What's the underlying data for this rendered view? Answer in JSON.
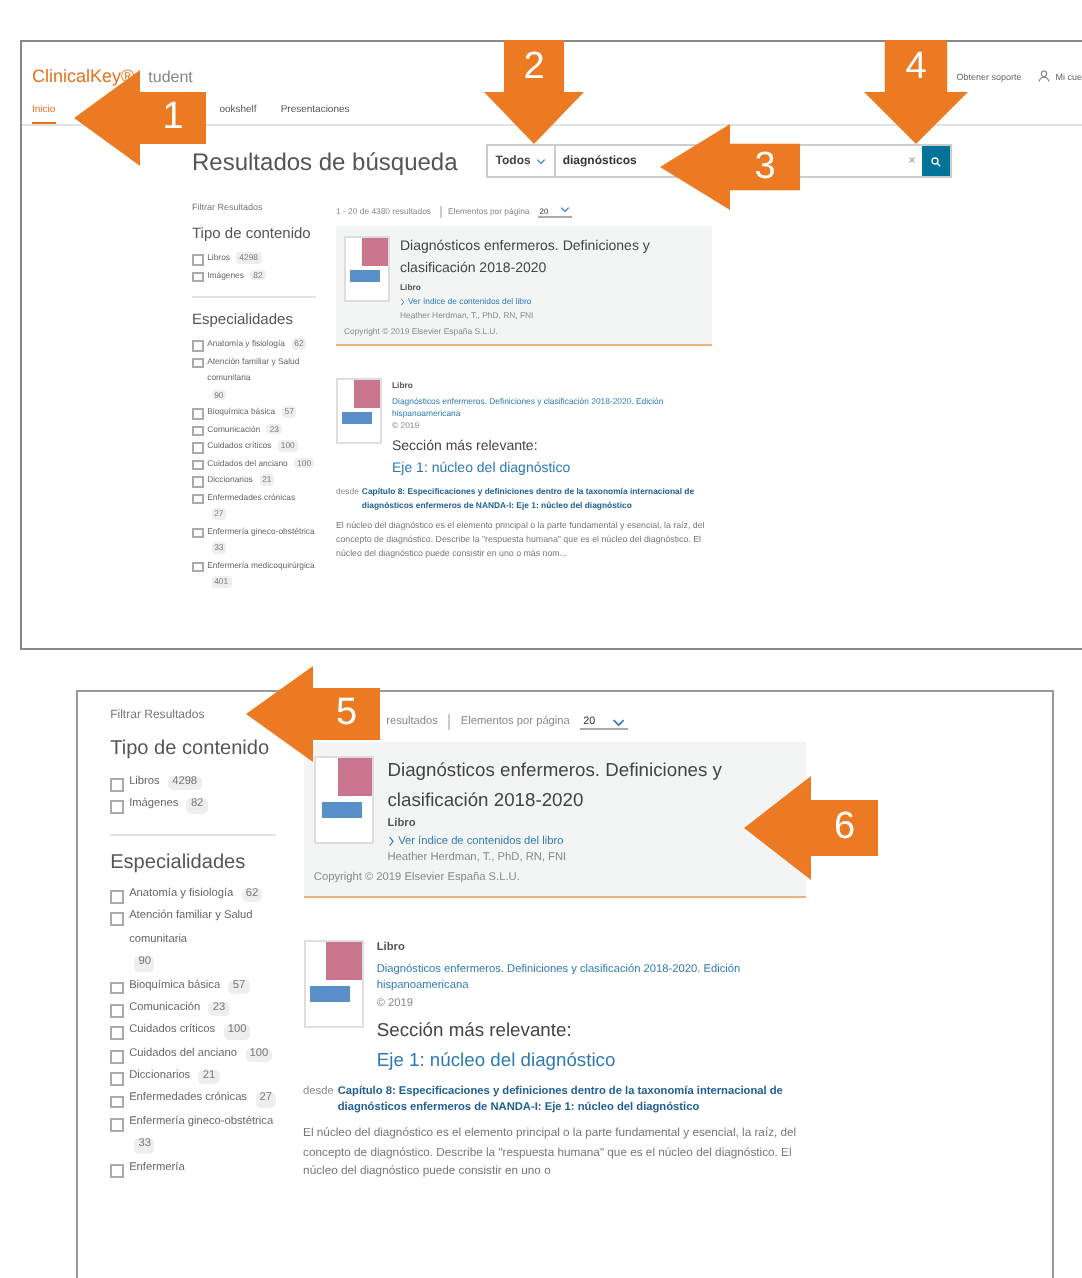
{
  "top_view": {
    "header": {
      "logo": "ClinicalKey®",
      "logo_suffix": "tudent",
      "nav": [
        {
          "label": "Inicio",
          "selected": true
        },
        {
          "label": "ookshelf",
          "selected": false
        },
        {
          "label": "Presentaciones",
          "selected": false
        }
      ],
      "support_link": "Obtener soporte",
      "account_link": "Mi cue"
    },
    "page_title": "Resultados de búsqueda",
    "search": {
      "scope": "Todos",
      "value": "diagnósticos",
      "clear_symbol": "×"
    },
    "results_bar": {
      "count": "1 - 20 de 4380 resultados",
      "per_page_label": "Elementos por página",
      "per_page": "20"
    },
    "filters": {
      "title": "Filtrar Resultados",
      "groups": [
        {
          "title": "Tipo de contenido",
          "options": [
            {
              "label": "Libros",
              "count": "4298",
              "checked": false
            },
            {
              "label": "Imágenes",
              "count": "82",
              "checked": false
            }
          ]
        },
        {
          "title": "Especialidades",
          "options": [
            {
              "label": "Anatomía y fisiología",
              "count": "62",
              "checked": false
            },
            {
              "label": "Atención familiar y Salud comunitaria",
              "count": "90",
              "checked": false
            },
            {
              "label": "Bioquímica básica",
              "count": "57",
              "checked": false
            },
            {
              "label": "Comunicación",
              "count": "23",
              "checked": false
            },
            {
              "label": "Cuidados críticos",
              "count": "100",
              "checked": false
            },
            {
              "label": "Cuidados del anciano",
              "count": "100",
              "checked": false
            },
            {
              "label": "Diccionarios",
              "count": "21",
              "checked": false
            },
            {
              "label": "Enfermedades crónicas",
              "count": "27",
              "checked": false
            },
            {
              "label": "Enfermería gineco-obstétrica",
              "count": "33",
              "checked": false
            },
            {
              "label": "Enfermería medicoquirúrgica",
              "count": "401",
              "checked": false
            }
          ]
        }
      ]
    },
    "results": [
      {
        "kind": "book",
        "highlighted": true,
        "title": "Diagnósticos enfermeros. Definiciones y clasificación 2018-2020",
        "type": "Libro",
        "toc_link": "Ver índice de contenidos del libro",
        "author": "Heather Herdman, T., PhD, RN, FNI",
        "copyright": "Copyright © 2019 Elsevier España S.L.U."
      },
      {
        "kind": "section",
        "type": "Libro",
        "source_link": "Diagnósticos enfermeros. Definiciones y clasificación 2018-2020. Edición hispanoamericana",
        "source_year": "© 2019",
        "section_label": "Sección más relevante:",
        "section_link": "Eje 1: núcleo del diagnóstico",
        "from_label": "desde",
        "from_link": "Capítulo 8: Especificaciones y definiciones dentro de la taxonomía internacional de diagnósticos enfermeros de NANDA-I: Eje 1: núcleo del diagnóstico",
        "snippet": "El núcleo del diagnóstico es el elemento principal o la parte fundamental y esencial, la raíz, del concepto de diagnóstico. Describe la \"respuesta humana\" que es el núcleo del diagnóstico. El núcleo del diagnóstico puede consistir en uno o más nom..."
      }
    ]
  },
  "bottom_view": {
    "results_bar": {
      "count": "resultados",
      "per_page_label": "Elementos por página",
      "per_page": "20"
    },
    "filters": {
      "title": "Filtrar Resultados",
      "groups": [
        {
          "title": "Tipo de contenido",
          "options": [
            {
              "label": "Libros",
              "count": "4298",
              "checked": false
            },
            {
              "label": "Imágenes",
              "count": "82",
              "checked": false
            }
          ]
        },
        {
          "title": "Especialidades",
          "options": [
            {
              "label": "Anatomía y fisiología",
              "count": "62",
              "checked": false
            },
            {
              "label": "Atención familiar y Salud comunitaria",
              "count": "90",
              "checked": false
            },
            {
              "label": "Bioquímica básica",
              "count": "57",
              "checked": false
            },
            {
              "label": "Comunicación",
              "count": "23",
              "checked": false
            },
            {
              "label": "Cuidados críticos",
              "count": "100",
              "checked": false
            },
            {
              "label": "Cuidados del anciano",
              "count": "100",
              "checked": false
            },
            {
              "label": "Diccionarios",
              "count": "21",
              "checked": false
            },
            {
              "label": "Enfermedades crónicas",
              "count": "27",
              "checked": false
            },
            {
              "label": "Enfermería gineco-obstétrica",
              "count": "33",
              "checked": false
            },
            {
              "label": "Enfermería",
              "checked": false
            }
          ]
        }
      ]
    },
    "results": [
      {
        "kind": "book",
        "highlighted": true,
        "title": "Diagnósticos enfermeros. Definiciones y clasificación 2018-2020",
        "type": "Libro",
        "toc_link": "Ver índice de contenidos del libro",
        "author": "Heather Herdman, T., PhD, RN, FNI",
        "copyright": "Copyright © 2019 Elsevier España S.L.U."
      },
      {
        "kind": "section",
        "type": "Libro",
        "source_link": "Diagnósticos enfermeros. Definiciones y clasificación 2018-2020. Edición hispanoamericana",
        "source_year": "© 2019",
        "section_label": "Sección más relevante:",
        "section_link": "Eje 1: núcleo del diagnóstico",
        "from_label": "desde",
        "from_link": "Capítulo 8: Especificaciones y definiciones dentro de la taxonomía internacional de diagnósticos enfermeros de NANDA-I: Eje 1: núcleo del diagnóstico",
        "snippet": "El núcleo del diagnóstico es el elemento principal o la parte fundamental y esencial, la raíz, del concepto de diagnóstico. Describe la \"respuesta humana\" que es el núcleo del diagnóstico. El núcleo del diagnóstico puede consistir en uno o"
      }
    ]
  },
  "callouts": [
    {
      "number": "1"
    },
    {
      "number": "2"
    },
    {
      "number": "3"
    },
    {
      "number": "4"
    },
    {
      "number": "5"
    },
    {
      "number": "6"
    }
  ]
}
